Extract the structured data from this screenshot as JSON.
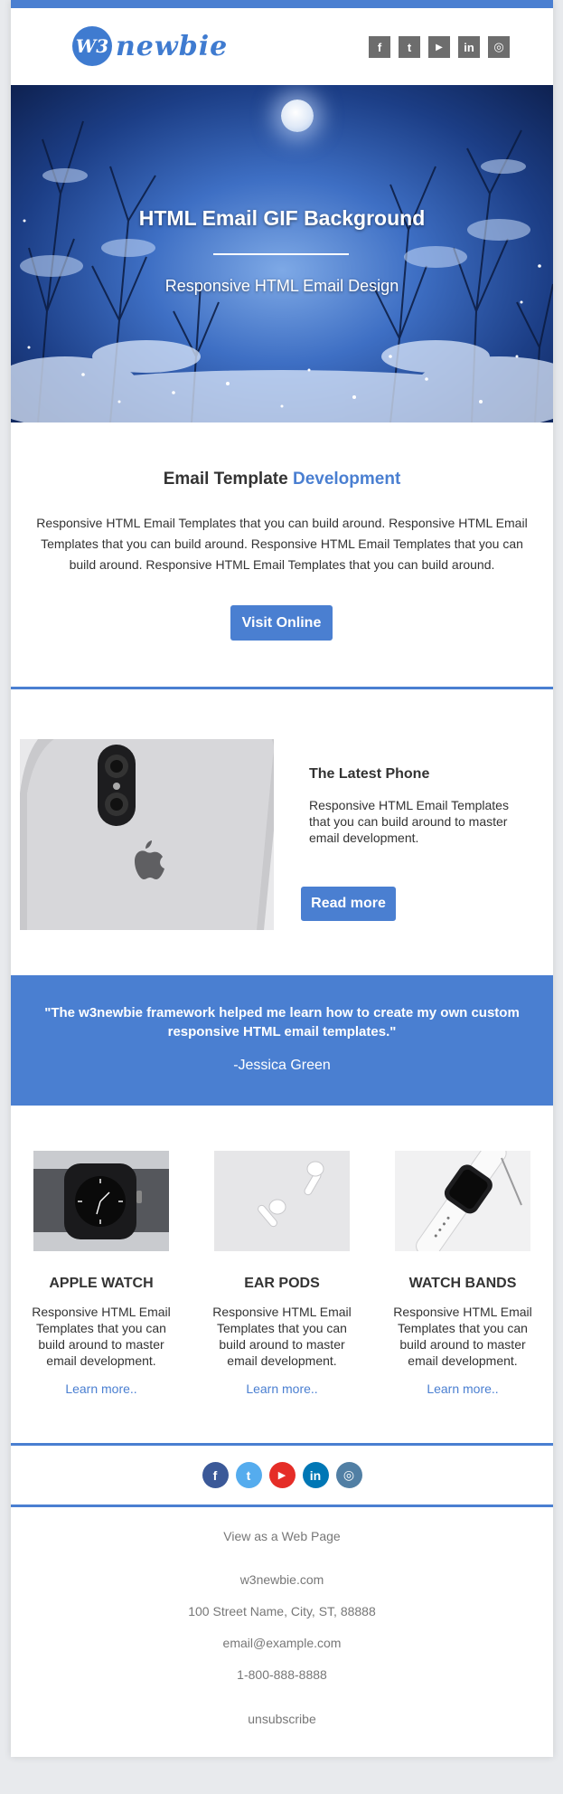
{
  "header": {
    "logo_badge": "W3",
    "logo_text": "newbie",
    "social": [
      {
        "icon": "facebook-icon",
        "glyph": "f"
      },
      {
        "icon": "twitter-icon",
        "glyph": "t"
      },
      {
        "icon": "youtube-icon",
        "glyph": "▶"
      },
      {
        "icon": "linkedin-icon",
        "glyph": "in"
      },
      {
        "icon": "instagram-icon",
        "glyph": "◎"
      }
    ]
  },
  "hero": {
    "title": "HTML Email GIF Background",
    "subtitle": "Responsive HTML Email Design"
  },
  "intro": {
    "title_plain": "Email Template ",
    "title_accent": "Development",
    "body": "Responsive HTML Email Templates that you can build around. Responsive HTML Email Templates that you can build around. Responsive HTML Email Templates that you can build around. Responsive HTML Email Templates that you can build around.",
    "button": "Visit Online"
  },
  "product": {
    "title": "The Latest Phone",
    "body": "Responsive HTML Email Templates that you can build around to master email development.",
    "button": "Read more"
  },
  "testimonial": {
    "quote": "\"The w3newbie framework helped me learn how to create my own custom responsive HTML email templates.\"",
    "author": "-Jessica Green"
  },
  "columns": [
    {
      "title": "APPLE WATCH",
      "body": "Responsive HTML Email Templates that you can build around to master email development.",
      "link": "Learn more.."
    },
    {
      "title": "EAR PODS",
      "body": "Responsive HTML Email Templates that you can build around to master email development.",
      "link": "Learn more.."
    },
    {
      "title": "WATCH BANDS",
      "body": "Responsive HTML Email Templates that you can build around to master email development.",
      "link": "Learn more.."
    }
  ],
  "footer_social": [
    {
      "icon": "facebook-icon",
      "glyph": "f",
      "color": "#3b5998"
    },
    {
      "icon": "twitter-icon",
      "glyph": "t",
      "color": "#55acee"
    },
    {
      "icon": "youtube-icon",
      "glyph": "▶",
      "color": "#e52d27"
    },
    {
      "icon": "linkedin-icon",
      "glyph": "in",
      "color": "#0077b5"
    },
    {
      "icon": "instagram-icon",
      "glyph": "◎",
      "color": "#517fa4"
    }
  ],
  "footer": {
    "web_view": "View as a Web Page",
    "site": "w3newbie.com",
    "address": "100 Street Name, City, ST, 88888",
    "email": "email@example.com",
    "phone": "1-800-888-8888",
    "unsubscribe": "unsubscribe"
  },
  "colors": {
    "accent": "#4a7fd1",
    "background": "#e8eaed"
  }
}
